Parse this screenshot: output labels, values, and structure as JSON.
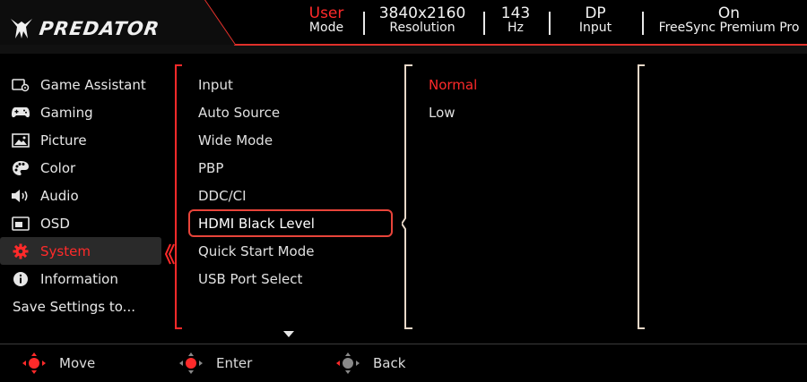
{
  "brand": {
    "logo_text": "PREDATOR"
  },
  "status": {
    "mode": {
      "value": "User",
      "label": "Mode"
    },
    "resolution": {
      "value": "3840x2160",
      "label": "Resolution"
    },
    "refresh": {
      "value": "143",
      "label": "Hz"
    },
    "input": {
      "value": "DP",
      "label": "Input"
    },
    "freesync": {
      "value": "On",
      "label": "FreeSync Premium Pro"
    }
  },
  "menu": {
    "items": [
      {
        "label": "Game Assistant",
        "icon": "game-assistant-icon"
      },
      {
        "label": "Gaming",
        "icon": "gamepad-icon"
      },
      {
        "label": "Picture",
        "icon": "picture-icon"
      },
      {
        "label": "Color",
        "icon": "palette-icon"
      },
      {
        "label": "Audio",
        "icon": "speaker-icon"
      },
      {
        "label": "OSD",
        "icon": "osd-icon"
      },
      {
        "label": "System",
        "icon": "gear-icon",
        "active": true
      },
      {
        "label": "Information",
        "icon": "info-icon"
      },
      {
        "label": "Save Settings to...",
        "icon": ""
      }
    ]
  },
  "submenu": {
    "items": [
      "Input",
      "Auto Source",
      "Wide Mode",
      "PBP",
      "DDC/CI",
      "HDMI Black Level",
      "Quick Start Mode",
      "USB Port Select"
    ],
    "selected_index": 5
  },
  "options": {
    "items": [
      "Normal",
      "Low"
    ],
    "current_index": 0
  },
  "footer": {
    "move": "Move",
    "enter": "Enter",
    "back": "Back"
  },
  "colors": {
    "accent_red": "#ff2a2a",
    "selection_border": "#e8443a",
    "background": "#000000",
    "active_row": "#2a2a2a"
  }
}
